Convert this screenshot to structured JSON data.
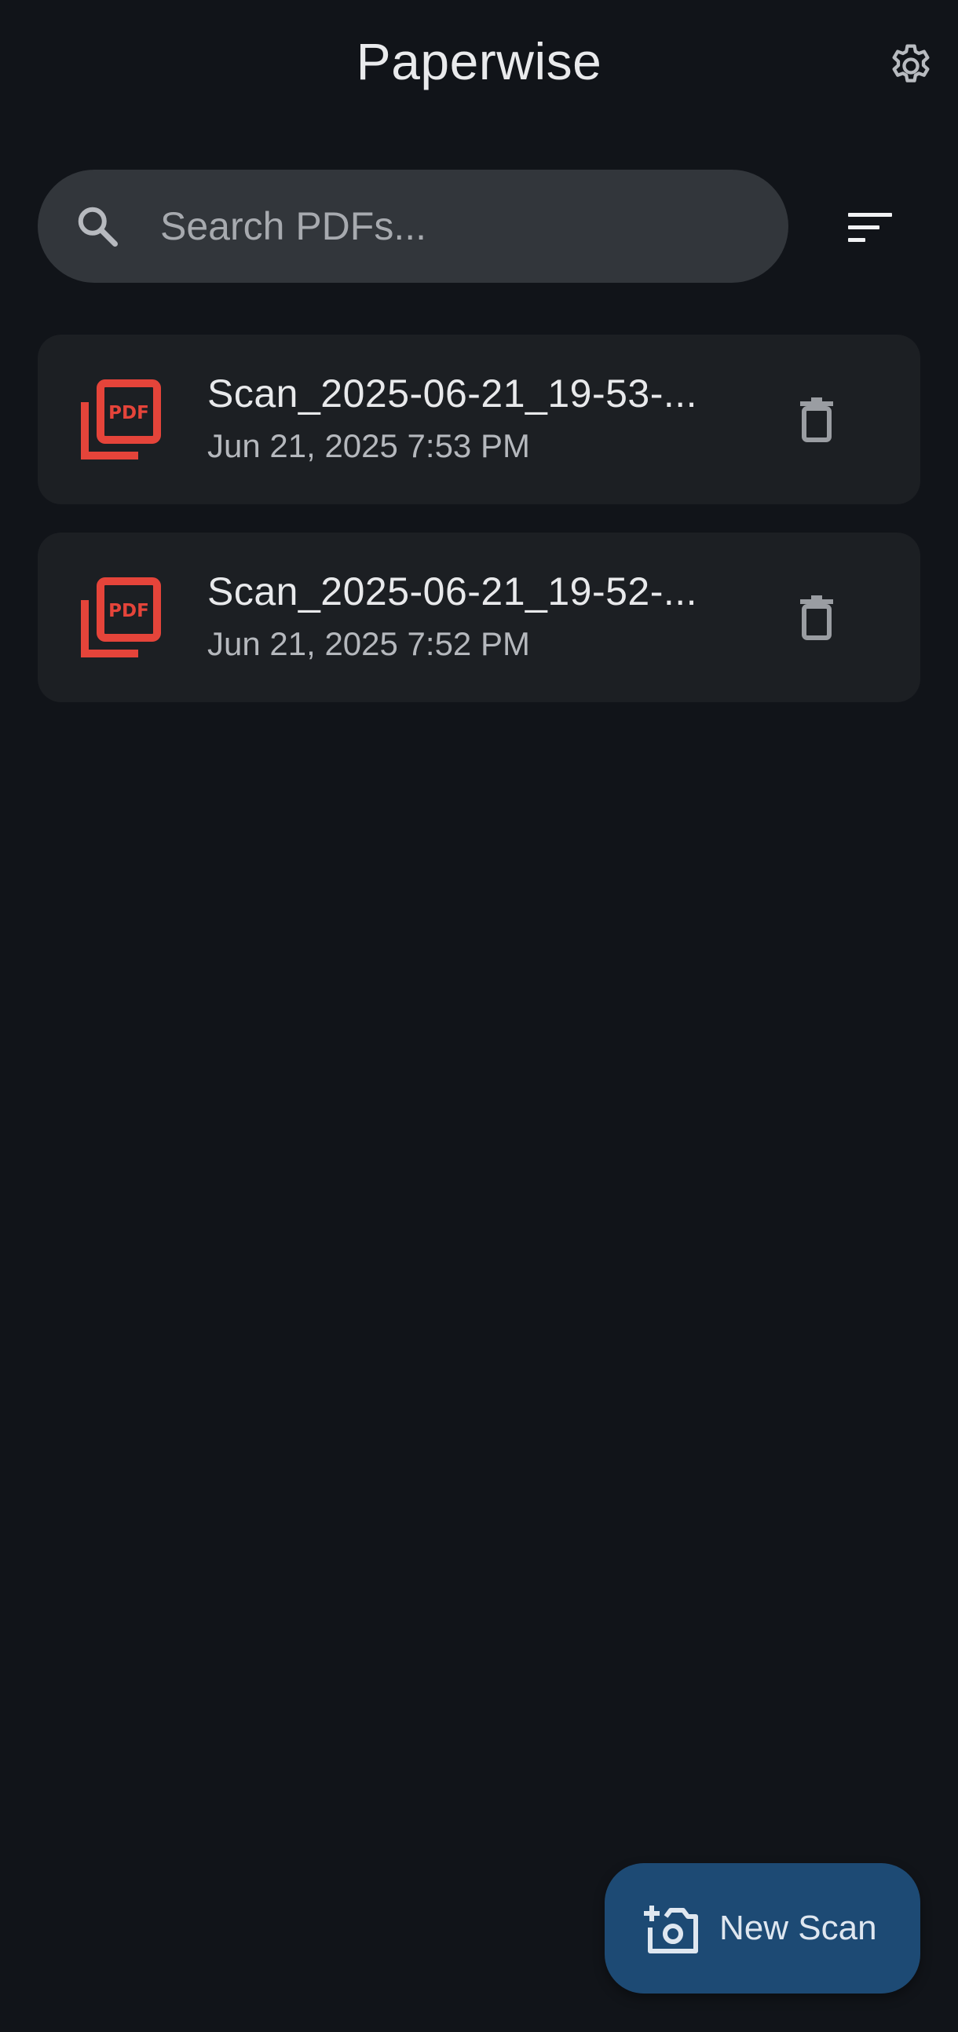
{
  "app": {
    "title": "Paperwise"
  },
  "header": {
    "settings_icon": "gear-icon"
  },
  "search": {
    "placeholder": "Search PDFs...",
    "value": "",
    "icon": "search-icon"
  },
  "sort": {
    "icon": "sort-icon"
  },
  "files": [
    {
      "name": "Scan_2025-06-21_19-53-...",
      "date": "Jun 21, 2025 7:53 PM",
      "icon": "pdf-icon",
      "action_icon": "trash-icon"
    },
    {
      "name": "Scan_2025-06-21_19-52-...",
      "date": "Jun 21, 2025 7:52 PM",
      "icon": "pdf-icon",
      "action_icon": "trash-icon"
    }
  ],
  "fab": {
    "label": "New Scan",
    "icon": "add-camera-icon"
  },
  "colors": {
    "background": "#111419",
    "surface": "#1c1f23",
    "search_surface": "#32363b",
    "pdf_accent": "#e5443a",
    "fab": "#1d4a74",
    "icon_muted": "#9a9da2"
  }
}
